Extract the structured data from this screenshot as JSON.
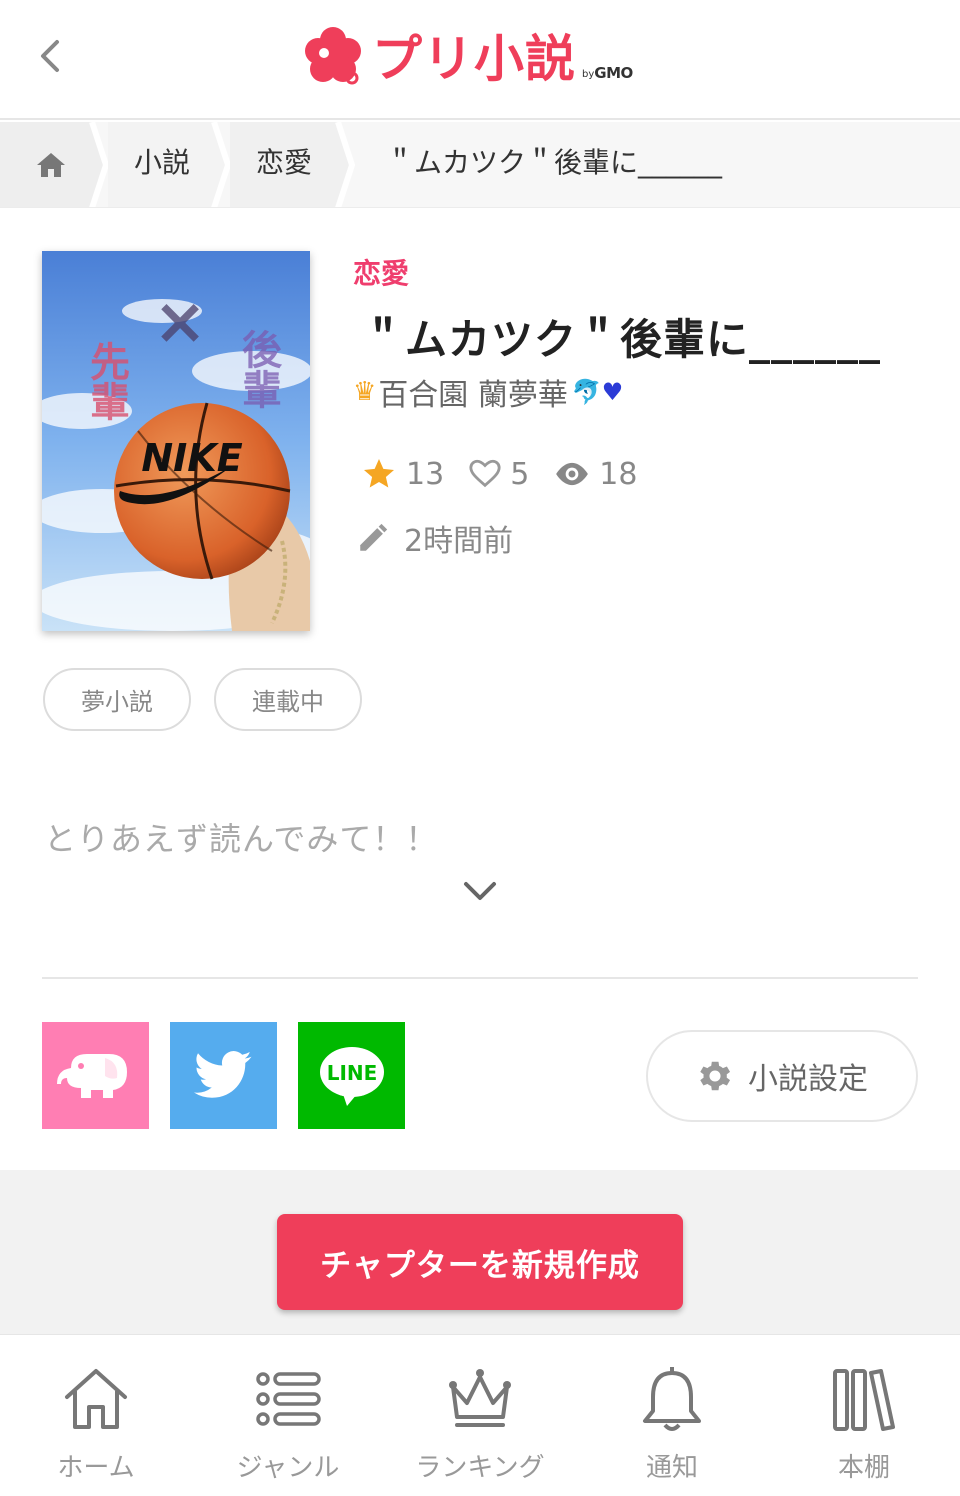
{
  "header": {
    "logo_text": "プリ小説",
    "logo_by": "by",
    "logo_brand": "GMO",
    "brand_color": "#ef3e5a"
  },
  "breadcrumb": {
    "items": [
      "小説",
      "恋愛",
      "＂ムカツク＂後輩に______"
    ]
  },
  "novel": {
    "genre": "恋愛",
    "title": "＂ムカツク＂後輩に______",
    "author": "百合園 蘭夢華",
    "stats": {
      "stars": "13",
      "likes": "5",
      "views": "18"
    },
    "updated": "2時間前",
    "tags": [
      "夢小説",
      "連載中"
    ],
    "description": "とりあえず読んでみて！！"
  },
  "cover": {
    "left_text": "先輩",
    "cross": "×",
    "right_text": "後輩",
    "brand": "NIKE"
  },
  "share": {
    "line_label": "LINE"
  },
  "actions": {
    "settings_label": "小説設定",
    "create_chapter_label": "チャプターを新規作成"
  },
  "bottom_nav": {
    "items": [
      {
        "label": "ホーム",
        "icon": "home-icon"
      },
      {
        "label": "ジャンル",
        "icon": "list-icon"
      },
      {
        "label": "ランキング",
        "icon": "crown-icon"
      },
      {
        "label": "通知",
        "icon": "bell-icon"
      },
      {
        "label": "本棚",
        "icon": "bookshelf-icon"
      }
    ]
  },
  "colors": {
    "accent": "#ef3e5a",
    "genre": "#ef3e6e",
    "star": "#f5a623",
    "share_elephant": "#ff7eb3",
    "share_twitter": "#55acee",
    "share_line": "#00b900"
  }
}
